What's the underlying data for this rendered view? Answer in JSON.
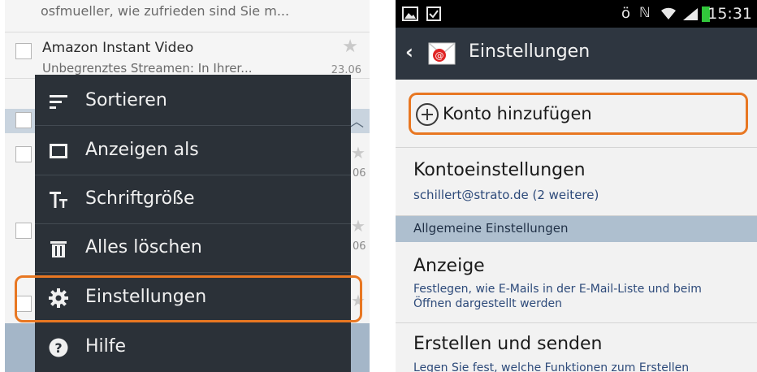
{
  "left": {
    "top_row": {
      "preview": "osfmueller, wie zufrieden sind Sie m..."
    },
    "row2": {
      "sender": "Amazon Instant Video",
      "preview": "Unbegrenztes Streamen: In Ihrer...",
      "date": "23.06"
    },
    "edge_dates": [
      "06",
      "06"
    ],
    "menu": {
      "items": [
        {
          "label": "Sortieren",
          "icon": "sort-icon"
        },
        {
          "label": "Anzeigen als",
          "icon": "view-icon"
        },
        {
          "label": "Schriftgröße",
          "icon": "font-size-icon"
        },
        {
          "label": "Alles löschen",
          "icon": "trash-icon"
        },
        {
          "label": "Einstellungen",
          "icon": "gear-icon"
        },
        {
          "label": "Hilfe",
          "icon": "help-icon"
        }
      ]
    }
  },
  "right": {
    "status_time": "15:31",
    "title": "Einstellungen",
    "add_account": "Konto hinzufügen",
    "account_settings": {
      "title": "Kontoeinstellungen",
      "sub": "schillert@strato.de (2 weitere)"
    },
    "section_header": "Allgemeine Einstellungen",
    "display": {
      "title": "Anzeige",
      "sub": "Festlegen, wie E-Mails in der E-Mail-Liste und beim Öffnen dargestellt werden"
    },
    "compose": {
      "title": "Erstellen und senden",
      "sub": "Legen Sie fest, welche Funktionen zum Erstellen"
    }
  },
  "colors": {
    "highlight": "#e87722",
    "menu_bg": "#2b3138",
    "actionbar": "#2e3640",
    "section": "#aebfcf"
  }
}
